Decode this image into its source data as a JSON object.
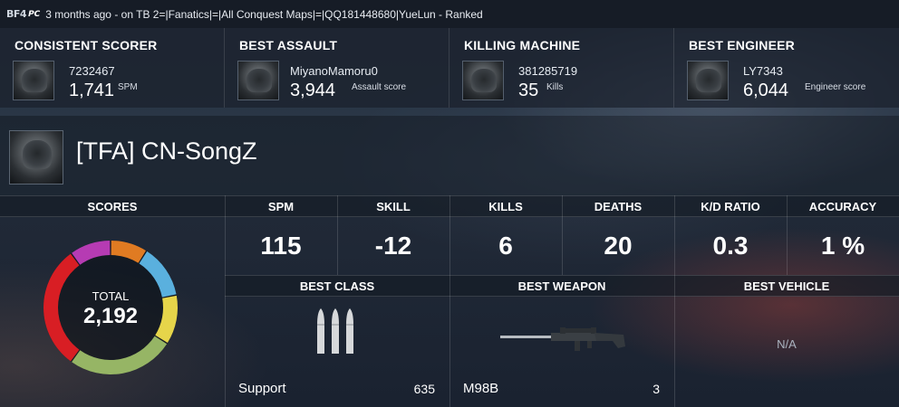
{
  "topbar": {
    "game_logo": "BF4",
    "platform_logo": "PC",
    "server_text": "3 months ago - on TB 2=|Fanatics|=|All Conquest Maps|=|QQ181448680|YueLun - Ranked"
  },
  "awards": [
    {
      "title": "CONSISTENT SCORER",
      "player": "7232467",
      "value": "1,741",
      "unit": "SPM"
    },
    {
      "title": "BEST ASSAULT",
      "player": "MiyanoMamoru0",
      "value": "3,944",
      "unit": "Assault score"
    },
    {
      "title": "KILLING MACHINE",
      "player": "381285719",
      "value": "35",
      "unit": "Kills"
    },
    {
      "title": "BEST ENGINEER",
      "player": "LY7343",
      "value": "6,044",
      "unit": "Engineer score"
    }
  ],
  "player": {
    "name": "[TFA] CN-SongZ"
  },
  "scores": {
    "header": "SCORES",
    "total_label": "TOTAL",
    "total_value": "2,192",
    "segments": [
      {
        "color": "#e07b22",
        "fraction": 0.09
      },
      {
        "color": "#5ab0de",
        "fraction": 0.13
      },
      {
        "color": "#e6d54a",
        "fraction": 0.12
      },
      {
        "color": "#96b565",
        "fraction": 0.26
      },
      {
        "color": "#d81e24",
        "fraction": 0.3
      },
      {
        "color": "#b63bb3",
        "fraction": 0.1
      }
    ]
  },
  "stats": [
    {
      "label": "SPM",
      "value": "115"
    },
    {
      "label": "SKILL",
      "value": "-12"
    },
    {
      "label": "KILLS",
      "value": "6"
    },
    {
      "label": "DEATHS",
      "value": "20"
    },
    {
      "label": "K/D RATIO",
      "value": "0.3"
    },
    {
      "label": "ACCURACY",
      "value": "1 %"
    }
  ],
  "best": {
    "class": {
      "header": "BEST CLASS",
      "name": "Support",
      "score": "635",
      "icon": "ammo-icon"
    },
    "weapon": {
      "header": "BEST WEAPON",
      "name": "M98B",
      "score": "3",
      "icon": "sniper-rifle-icon"
    },
    "vehicle": {
      "header": "BEST VEHICLE",
      "value": "N/A"
    }
  }
}
